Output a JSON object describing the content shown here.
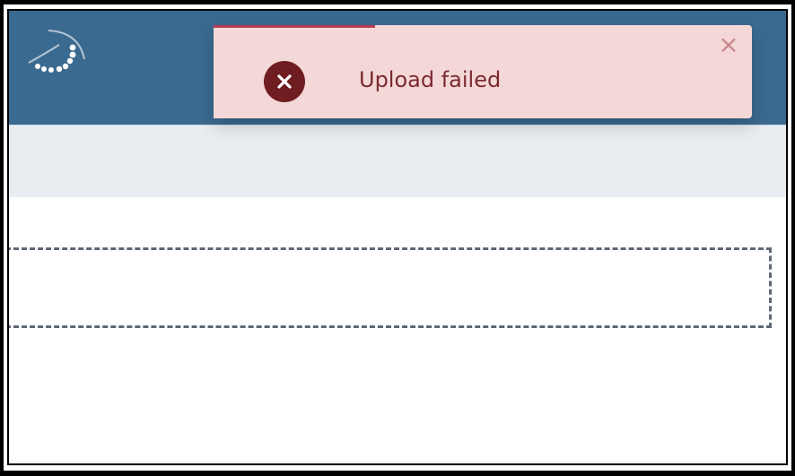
{
  "toast": {
    "message": "Upload failed",
    "status": "error",
    "close_glyph": "×",
    "icon": "error-x-icon",
    "colors": {
      "background": "#f4d8d8",
      "text": "#7b2a2f",
      "icon_bg": "#6f1d20",
      "accent": "#b43a55"
    }
  },
  "header": {
    "logo_icon": "pearl-necklace-logo",
    "background": "#3b6a90"
  },
  "dropzone": {
    "border_color": "#5f6873"
  }
}
